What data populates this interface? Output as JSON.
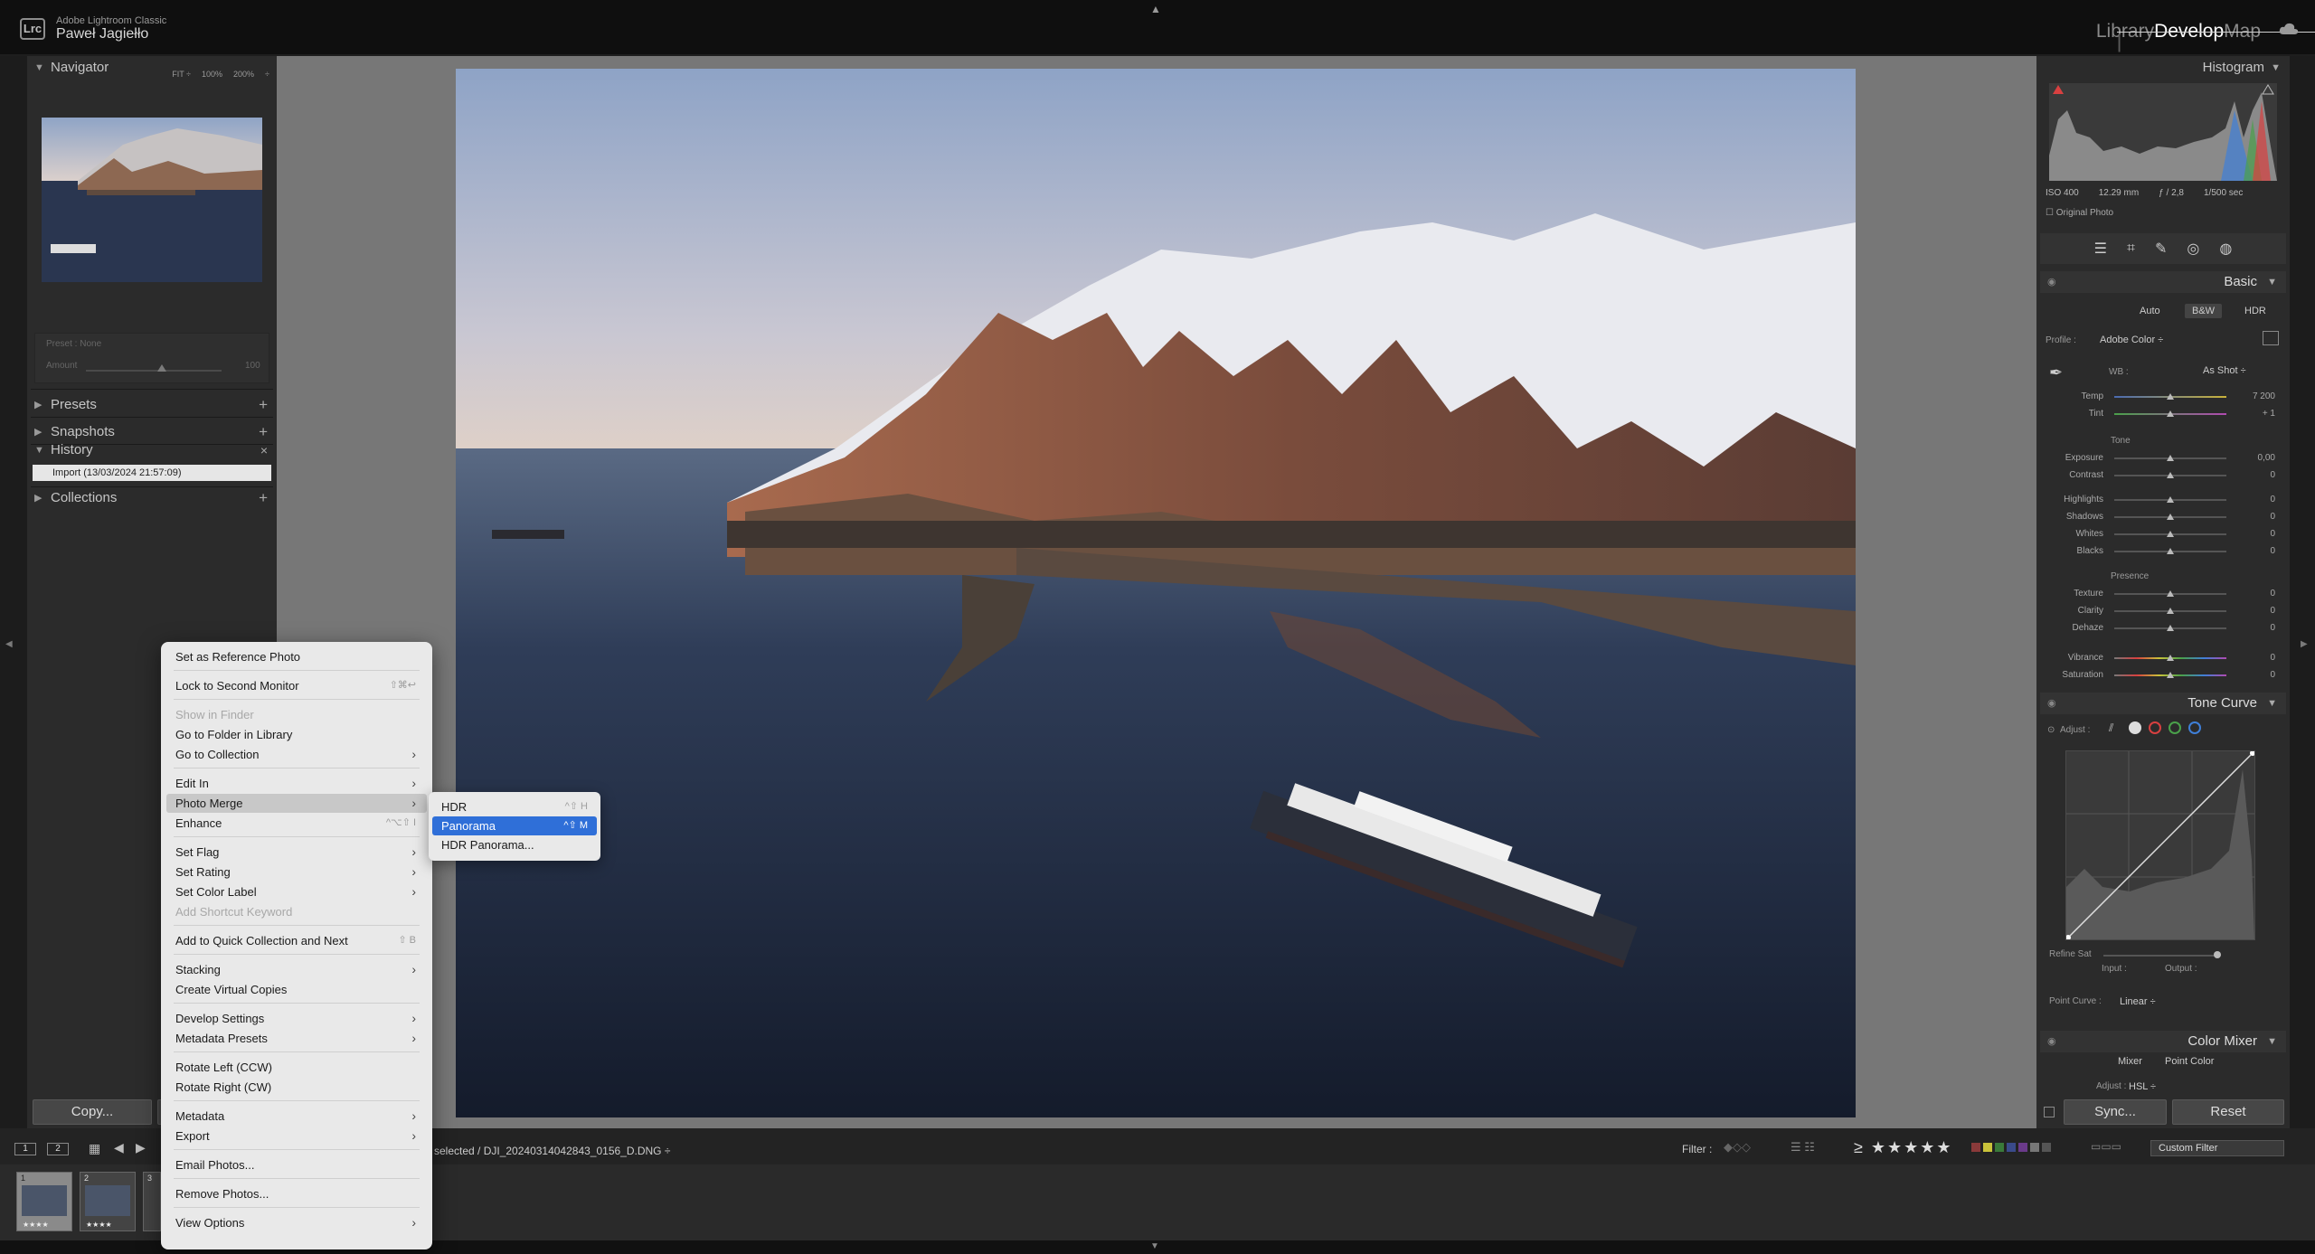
{
  "app": {
    "title": "Adobe Lightroom Classic",
    "user": "Paweł Jagiełło",
    "logo": "Lrc",
    "modules": [
      "Library",
      "Develop",
      "Map"
    ],
    "active_module": "Develop"
  },
  "left_panel": {
    "navigator": {
      "label": "Navigator",
      "options": [
        "FIT ÷",
        "100%",
        "200%",
        "÷"
      ]
    },
    "preset_box": {
      "preset": "Preset : None",
      "amount": "Amount",
      "amount_value": "100"
    },
    "presets": "Presets",
    "snapshots": "Snapshots",
    "history": {
      "label": "History",
      "item": "Import (13/03/2024 21:57:09)"
    },
    "collections": "Collections",
    "copy_button": "Copy..."
  },
  "right_panel": {
    "histogram": {
      "label": "Histogram",
      "meta": [
        "ISO 400",
        "12.29 mm",
        "ƒ / 2,8",
        "1/500 sec"
      ],
      "original_photo": "Original Photo"
    },
    "basic": {
      "label": "Basic",
      "treatments": [
        "Auto",
        "B&W",
        "HDR"
      ],
      "profile_label": "Profile :",
      "profile_value": "Adobe Color ÷",
      "wb_label": "WB :",
      "wb_value": "As Shot ÷",
      "wb_sliders": [
        {
          "label": "Temp",
          "value": "7 200",
          "pos": 0.5
        },
        {
          "label": "Tint",
          "value": "+ 1",
          "pos": 0.5
        }
      ],
      "tone_label": "Tone",
      "tone_sliders": [
        {
          "label": "Exposure",
          "value": "0,00",
          "pos": 0.5
        },
        {
          "label": "Contrast",
          "value": "0",
          "pos": 0.5
        },
        {
          "label": "Highlights",
          "value": "0",
          "pos": 0.5
        },
        {
          "label": "Shadows",
          "value": "0",
          "pos": 0.5
        },
        {
          "label": "Whites",
          "value": "0",
          "pos": 0.5
        },
        {
          "label": "Blacks",
          "value": "0",
          "pos": 0.5
        }
      ],
      "presence_label": "Presence",
      "presence_sliders": [
        {
          "label": "Texture",
          "value": "0",
          "pos": 0.5
        },
        {
          "label": "Clarity",
          "value": "0",
          "pos": 0.5
        },
        {
          "label": "Dehaze",
          "value": "0",
          "pos": 0.5
        },
        {
          "label": "Vibrance",
          "value": "0",
          "pos": 0.5
        },
        {
          "label": "Saturation",
          "value": "0",
          "pos": 0.5
        }
      ]
    },
    "tone_curve": {
      "label": "Tone Curve",
      "adjust": "Adjust :",
      "refine": "Refine Sat",
      "input": "Input :",
      "output": "Output :",
      "point_curve_label": "Point Curve :",
      "point_curve_value": "Linear ÷"
    },
    "color_mixer": {
      "label": "Color Mixer",
      "tabs": [
        "Mixer",
        "Point Color"
      ],
      "adjust": "Adjust :",
      "adjust_value": "HSL ÷"
    },
    "sync_button": "Sync...",
    "reset_button": "Reset"
  },
  "filmbar": {
    "pages": [
      "1",
      "2"
    ],
    "filename": "selected / DJI_20240314042843_0156_D.DNG ÷",
    "filter_label": "Filter :",
    "stars": "≥ ★★★★★",
    "custom_filter": "Custom Filter"
  },
  "filmstrip": [
    {
      "num": "1",
      "stars": "★★★★",
      "selected": true
    },
    {
      "num": "2",
      "stars": "★★★★",
      "selected": false
    },
    {
      "num": "3",
      "stars": "",
      "selected": false
    }
  ],
  "context_menu": [
    {
      "label": "Set as Reference Photo"
    },
    {
      "label": "Lock to Second Monitor",
      "shortcut": "⇧⌘↩"
    },
    {
      "label": "Show in Finder",
      "disabled": true
    },
    {
      "label": "Go to Folder in Library"
    },
    {
      "label": "Go to Collection",
      "submenu": true
    },
    {
      "label": "Edit In",
      "submenu": true
    },
    {
      "label": "Photo Merge",
      "submenu": true,
      "highlighted": true
    },
    {
      "label": "Enhance",
      "shortcut": "^⌥⇧ I"
    },
    {
      "label": "Set Flag",
      "submenu": true
    },
    {
      "label": "Set Rating",
      "submenu": true
    },
    {
      "label": "Set Color Label",
      "submenu": true
    },
    {
      "label": "Add Shortcut Keyword",
      "disabled": true
    },
    {
      "label": "Add to Quick Collection and Next",
      "shortcut": "⇧ B"
    },
    {
      "label": "Stacking",
      "submenu": true
    },
    {
      "label": "Create Virtual Copies"
    },
    {
      "label": "Develop Settings",
      "submenu": true
    },
    {
      "label": "Metadata Presets",
      "submenu": true
    },
    {
      "label": "Rotate Left (CCW)"
    },
    {
      "label": "Rotate Right (CW)"
    },
    {
      "label": "Metadata",
      "submenu": true
    },
    {
      "label": "Export",
      "submenu": true
    },
    {
      "label": "Email Photos..."
    },
    {
      "label": "Remove Photos..."
    },
    {
      "label": "View Options",
      "submenu": true
    }
  ],
  "photo_merge_submenu": [
    {
      "label": "HDR",
      "shortcut": "^⇧ H"
    },
    {
      "label": "Panorama",
      "shortcut": "^⇧ M",
      "selected": true
    },
    {
      "label": "HDR Panorama..."
    }
  ]
}
